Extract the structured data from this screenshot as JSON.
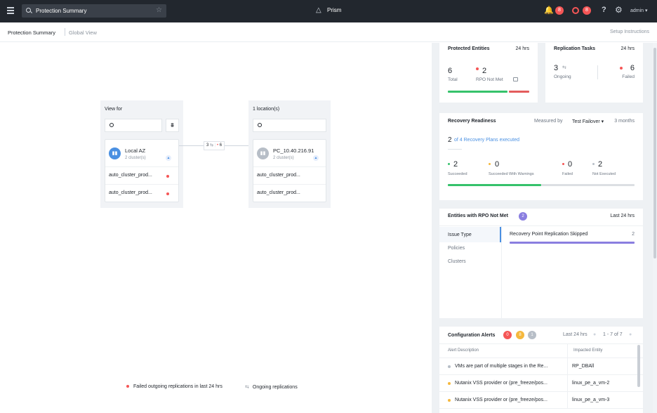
{
  "topbar": {
    "search_value": "Protection Summary",
    "brand": "Prism",
    "alerts_count": "8",
    "events_count": "8",
    "help": "?",
    "user": "admin"
  },
  "subheader": {
    "breadcrumb_active": "Protection Summary",
    "breadcrumb_link": "Global View",
    "setup_link": "Setup Instructions"
  },
  "left_group": {
    "title": "View for",
    "az_name": "Local AZ",
    "az_sub": "2 cluster(s)",
    "rows": [
      "auto_cluster_prod...",
      "auto_cluster_prod..."
    ]
  },
  "connector": {
    "ongoing": "3",
    "ongoing_icon": "⇆",
    "failed": "6"
  },
  "right_group": {
    "title": "1 location(s)",
    "az_name": "PC_10.40.216.91",
    "az_sub": "2 cluster(s)",
    "rows": [
      "auto_cluster_prod...",
      "auto_cluster_prod..."
    ]
  },
  "legend": {
    "failed": "Failed outgoing replications in last 24 hrs",
    "ongoing": "Ongoing replications"
  },
  "protected_entities": {
    "title": "Protected Entities",
    "period": "24 hrs",
    "total": "6",
    "total_label": "Total",
    "rpo_not_met": "2",
    "rpo_label": "RPO Not Met"
  },
  "replication_tasks": {
    "title": "Replication Tasks",
    "period": "24 hrs",
    "ongoing": "3",
    "ongoing_label": "Ongoing",
    "failed": "6",
    "failed_label": "Failed"
  },
  "recovery_readiness": {
    "title": "Recovery Readiness",
    "measured_by_label": "Measured by",
    "measured_by_value": "Test Failover",
    "period": "3 months",
    "executed_count": "2",
    "executed_text": "of 4 Recovery Plans executed",
    "stats": [
      {
        "value": "2",
        "label": "Succeeded",
        "color": "#36c26b"
      },
      {
        "value": "0",
        "label": "Succeeded With Warnings",
        "color": "#f5b83d"
      },
      {
        "value": "0",
        "label": "Failed",
        "color": "#f55656"
      },
      {
        "value": "2",
        "label": "Not Executed",
        "color": "#b7bec7"
      }
    ]
  },
  "rpo_not_met": {
    "title": "Entities with RPO Not Met",
    "count": "2",
    "period": "Last 24 hrs",
    "tabs": [
      "Issue Type",
      "Policies",
      "Clusters"
    ],
    "issue": "Recovery Point Replication Skipped",
    "issue_count": "2"
  },
  "config_alerts": {
    "title": "Configuration Alerts",
    "badges": [
      {
        "value": "0",
        "color": "#f55656"
      },
      {
        "value": "8",
        "color": "#f5b83d"
      },
      {
        "value": "1",
        "color": "#b7bec7"
      }
    ],
    "period": "Last 24 hrs",
    "pagination": "1 - 7 of 7",
    "col_desc": "Alert Description",
    "col_entity": "Impacted Entity",
    "rows": [
      {
        "desc": "VMs are part of multiple stages in the Re...",
        "entity": "RP_DBAll",
        "color": "#b7bec7"
      },
      {
        "desc": "Nutanix VSS provider or (pre_freeze/pos...",
        "entity": "linux_pe_a_vm-2",
        "color": "#f5b83d"
      },
      {
        "desc": "Nutanix VSS provider or (pre_freeze/pos...",
        "entity": "linux_pe_a_vm-3",
        "color": "#f5b83d"
      }
    ]
  }
}
